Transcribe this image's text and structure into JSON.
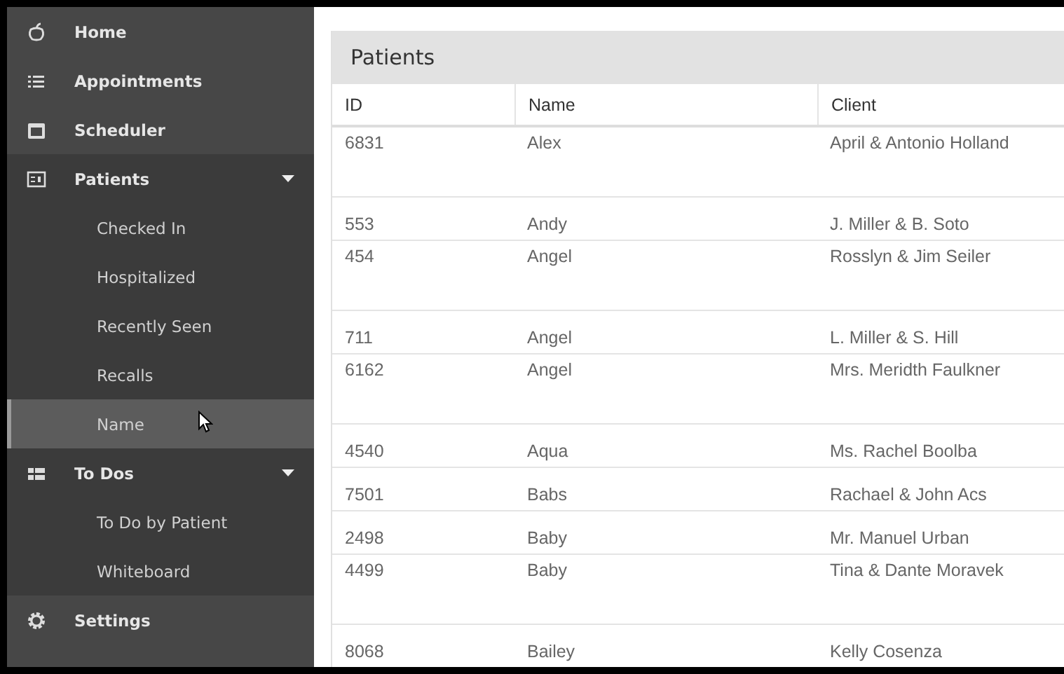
{
  "sidebar": {
    "items": [
      {
        "label": "Home",
        "selected": false,
        "expanded": false
      },
      {
        "label": "Appointments",
        "selected": false,
        "expanded": false
      },
      {
        "label": "Scheduler",
        "selected": false,
        "expanded": false
      },
      {
        "label": "Patients",
        "selected": false,
        "expanded": true,
        "children": [
          {
            "label": "Checked In",
            "selected": false
          },
          {
            "label": "Hospitalized",
            "selected": false
          },
          {
            "label": "Recently Seen",
            "selected": false
          },
          {
            "label": "Recalls",
            "selected": false
          },
          {
            "label": "Name",
            "selected": true
          }
        ]
      },
      {
        "label": "To Dos",
        "selected": false,
        "expanded": true,
        "children": [
          {
            "label": "To Do by Patient",
            "selected": false
          },
          {
            "label": "Whiteboard",
            "selected": false
          }
        ]
      },
      {
        "label": "Settings",
        "selected": false,
        "expanded": false
      }
    ]
  },
  "panel": {
    "title": "Patients"
  },
  "table": {
    "columns": [
      "ID",
      "Name",
      "Client"
    ],
    "rows": [
      {
        "kind": "double",
        "cells": [
          "6831",
          "Alex",
          "April & Antonio Holland"
        ]
      },
      {
        "kind": "single",
        "cells": [
          "553",
          "Andy",
          "J. Miller & B. Soto"
        ]
      },
      {
        "kind": "double",
        "cells": [
          "454",
          "Angel",
          "Rosslyn & Jim Seiler"
        ]
      },
      {
        "kind": "single",
        "cells": [
          "711",
          "Angel",
          "L. Miller & S. Hill"
        ]
      },
      {
        "kind": "double",
        "cells": [
          "6162",
          "Angel",
          "Mrs. Meridth Faulkner"
        ]
      },
      {
        "kind": "single",
        "cells": [
          "4540",
          "Aqua",
          "Ms. Rachel Boolba"
        ]
      },
      {
        "kind": "single",
        "cells": [
          "7501",
          "Babs",
          "Rachael & John Acs"
        ]
      },
      {
        "kind": "single",
        "cells": [
          "2498",
          "Baby",
          "Mr. Manuel Urban"
        ]
      },
      {
        "kind": "double",
        "cells": [
          "4499",
          "Baby",
          "Tina & Dante Moravek"
        ]
      },
      {
        "kind": "single",
        "cells": [
          "8068",
          "Bailey",
          "Kelly Cosenza"
        ]
      }
    ]
  }
}
